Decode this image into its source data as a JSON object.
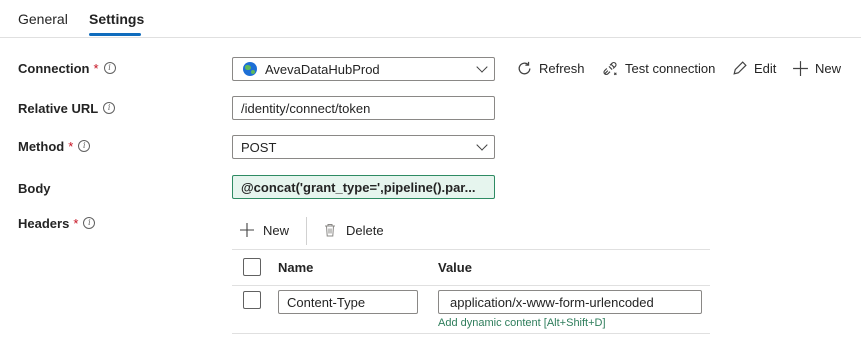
{
  "tabs": [
    {
      "label": "General",
      "active": false
    },
    {
      "label": "Settings",
      "active": true
    }
  ],
  "accent_color": "#0f6cbd",
  "form": {
    "connection": {
      "label": "Connection",
      "required": "*",
      "value": "AvevaDataHubProd",
      "icon": "globe-icon"
    },
    "relative_url": {
      "label": "Relative URL",
      "value": "/identity/connect/token"
    },
    "method": {
      "label": "Method",
      "required": "*",
      "value": "POST"
    },
    "body": {
      "label": "Body",
      "value": "@concat('grant_type=',pipeline().par..."
    },
    "headers": {
      "label": "Headers",
      "required": "*"
    }
  },
  "connection_actions": {
    "refresh": "Refresh",
    "test_connection": "Test connection",
    "edit": "Edit",
    "new": "New"
  },
  "headers_toolbar": {
    "new": "New",
    "delete": "Delete"
  },
  "headers_table": {
    "columns": [
      "Name",
      "Value"
    ],
    "rows": [
      {
        "name": "Content-Type",
        "value": "application/x-www-form-urlencoded"
      }
    ],
    "dynamic_link": "Add dynamic content [Alt+Shift+D]"
  }
}
